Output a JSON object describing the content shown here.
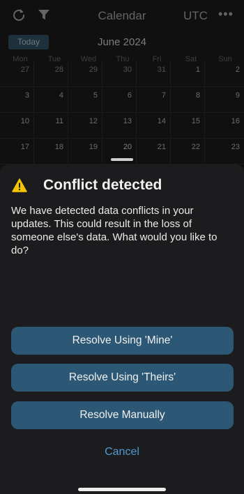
{
  "topbar": {
    "title": "Calendar",
    "timezone": "UTC",
    "more": "•••",
    "icons": [
      "refresh-icon",
      "filter-icon"
    ]
  },
  "calendar": {
    "today_label": "Today",
    "month_title": "June 2024",
    "weekdays": [
      "Mon",
      "Tue",
      "Wed",
      "Thu",
      "Fri",
      "Sat",
      "Sun"
    ],
    "weeks": [
      [
        "27",
        "28",
        "29",
        "30",
        "31",
        "1",
        "2"
      ],
      [
        "3",
        "4",
        "5",
        "6",
        "7",
        "8",
        "9"
      ],
      [
        "10",
        "11",
        "12",
        "13",
        "14",
        "15",
        "16"
      ],
      [
        "17",
        "18",
        "19",
        "20",
        "21",
        "22",
        "23"
      ]
    ]
  },
  "dialog": {
    "title": "Conflict detected",
    "message": "We have detected data conflicts in your updates. This could result in the loss of someone else's data. What would you like to do?",
    "buttons": {
      "mine": "Resolve Using 'Mine'",
      "theirs": "Resolve Using 'Theirs'",
      "manual": "Resolve Manually"
    },
    "cancel": "Cancel"
  },
  "colors": {
    "button_bg": "#2c5876",
    "cancel_text": "#4d9bd1",
    "warning_icon": "#f5c400"
  }
}
